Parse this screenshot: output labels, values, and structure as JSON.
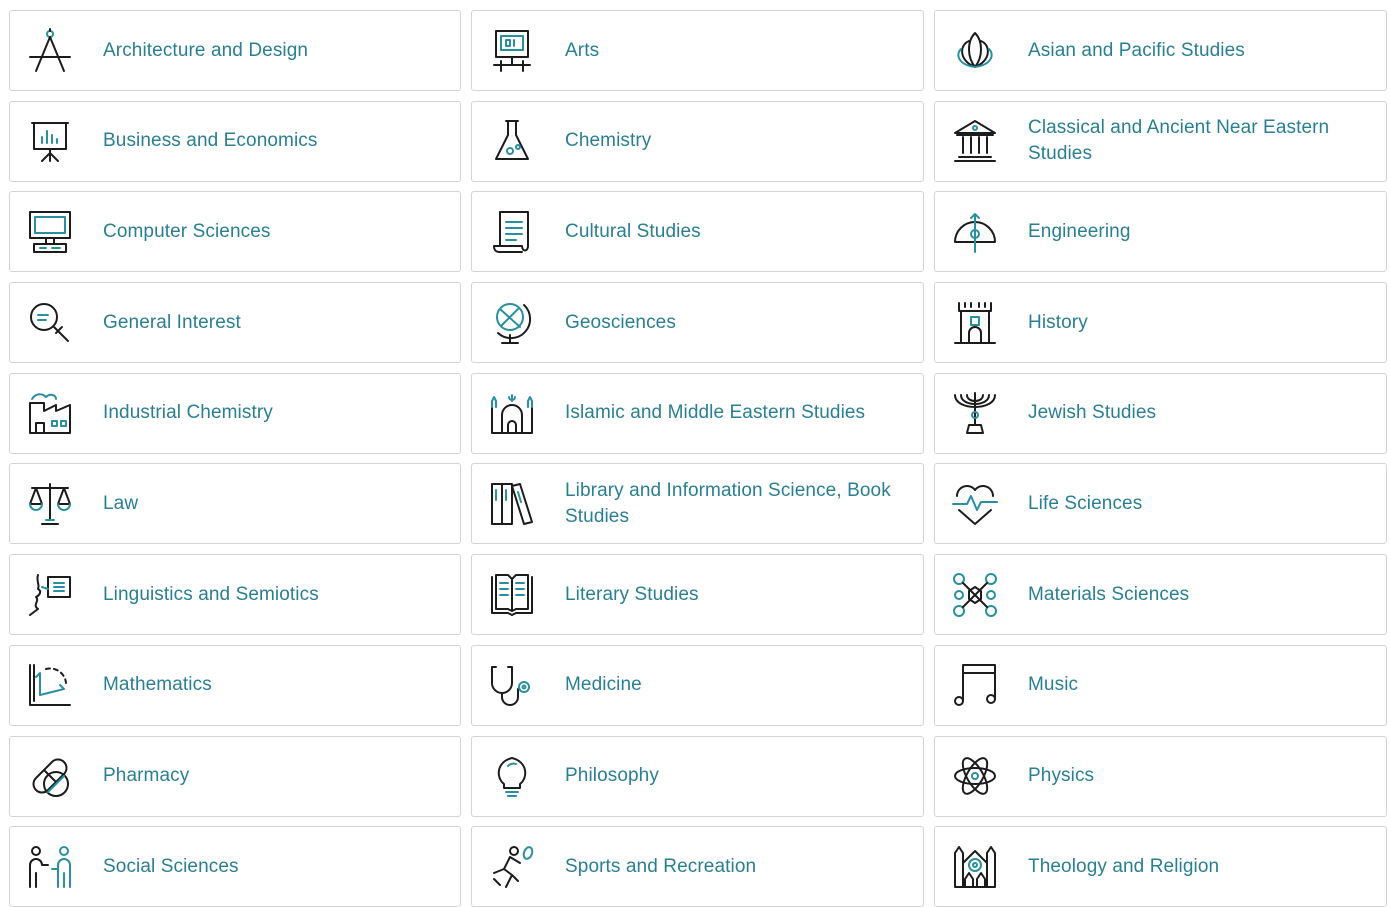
{
  "subjects": [
    {
      "label": "Architecture and Design",
      "icon": "compass-icon"
    },
    {
      "label": "Arts",
      "icon": "easel-painting-icon"
    },
    {
      "label": "Asian and Pacific Studies",
      "icon": "lotus-icon"
    },
    {
      "label": "Business and Economics",
      "icon": "presentation-chart-icon"
    },
    {
      "label": "Chemistry",
      "icon": "flask-icon"
    },
    {
      "label": "Classical and Ancient Near Eastern Studies",
      "icon": "temple-icon"
    },
    {
      "label": "Computer Sciences",
      "icon": "computer-icon"
    },
    {
      "label": "Cultural Studies",
      "icon": "scroll-icon"
    },
    {
      "label": "Engineering",
      "icon": "protractor-icon"
    },
    {
      "label": "General Interest",
      "icon": "magnifier-icon"
    },
    {
      "label": "Geosciences",
      "icon": "globe-icon"
    },
    {
      "label": "History",
      "icon": "castle-tower-icon"
    },
    {
      "label": "Industrial Chemistry",
      "icon": "factory-icon"
    },
    {
      "label": "Islamic and Middle Eastern Studies",
      "icon": "mosque-icon"
    },
    {
      "label": "Jewish Studies",
      "icon": "menorah-icon"
    },
    {
      "label": "Law",
      "icon": "scales-icon"
    },
    {
      "label": "Library and Information Science, Book Studies",
      "icon": "books-icon"
    },
    {
      "label": "Life Sciences",
      "icon": "heartbeat-icon"
    },
    {
      "label": "Linguistics and Semiotics",
      "icon": "speech-icon"
    },
    {
      "label": "Literary Studies",
      "icon": "open-book-icon"
    },
    {
      "label": "Materials Sciences",
      "icon": "molecule-icon"
    },
    {
      "label": "Mathematics",
      "icon": "graph-axes-icon"
    },
    {
      "label": "Medicine",
      "icon": "stethoscope-icon"
    },
    {
      "label": "Music",
      "icon": "music-note-icon"
    },
    {
      "label": "Pharmacy",
      "icon": "pills-icon"
    },
    {
      "label": "Philosophy",
      "icon": "lightbulb-icon"
    },
    {
      "label": "Physics",
      "icon": "atom-icon"
    },
    {
      "label": "Social Sciences",
      "icon": "people-icon"
    },
    {
      "label": "Sports and Recreation",
      "icon": "runner-icon"
    },
    {
      "label": "Theology and Religion",
      "icon": "cathedral-icon"
    }
  ],
  "colors": {
    "label": "#2a7f93",
    "icon_accent": "#2a8fa0",
    "icon_dark": "#1c1c1c",
    "border": "#d4d4d4"
  }
}
